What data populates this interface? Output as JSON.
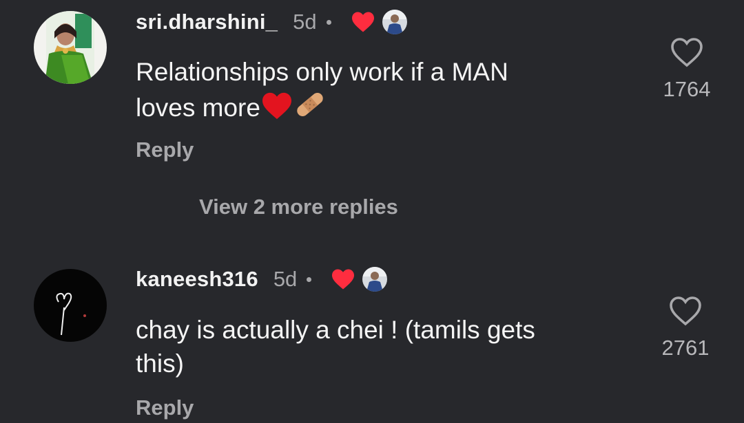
{
  "comments": [
    {
      "username": "sri.dharshini_",
      "time": "5d",
      "text_line1": "Relationships only work if a MAN",
      "text_line2": "loves more",
      "reply_label": "Reply",
      "like_count": "1764",
      "avatar_icon": "profile-photo-woman-green-saree",
      "emojis": [
        "red-heart-emoji",
        "adhesive-bandage-emoji"
      ]
    },
    {
      "username": "kaneesh316",
      "time": "5d",
      "text_line1": "chay is actually a chei ! (tamils gets",
      "text_line2": "this)",
      "reply_label": "Reply",
      "like_count": "2761",
      "avatar_icon": "profile-photo-dark-heart-doodle"
    }
  ],
  "view_more_replies": "View 2 more replies",
  "colors": {
    "background": "#27282c",
    "heart": "#ff2d3f",
    "secondary_text": "#a8a8ab"
  }
}
